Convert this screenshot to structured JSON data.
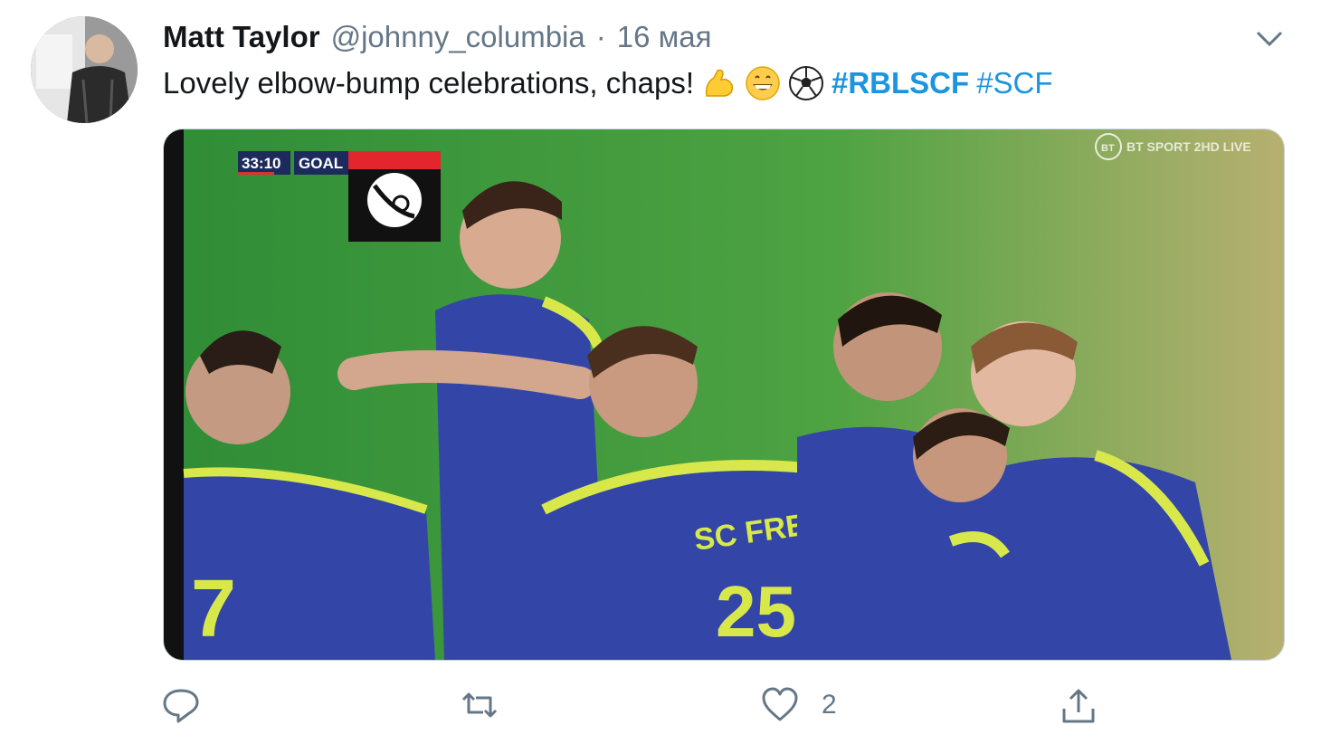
{
  "tweet": {
    "author_name": "Matt Taylor",
    "author_handle": "@johnny_columbia",
    "separator": "·",
    "date": "16 мая",
    "text": "Lovely elbow-bump celebrations, chaps!",
    "emojis": [
      "flexed-biceps-icon",
      "grinning-face-icon",
      "soccer-ball-icon"
    ],
    "hashtags": [
      "#RBLSCF",
      "#SCF"
    ]
  },
  "media": {
    "scorebug_time": "33:10",
    "scorebug_label": "GOAL",
    "broadcaster": "BT SPORT 2HD LIVE",
    "shirt_text": "SC FREIBURG",
    "shirt_number": "25"
  },
  "actions": {
    "reply_count": "",
    "retweet_count": "",
    "like_count": "2"
  },
  "colors": {
    "hashtag": "#1b95e0",
    "muted": "#657786",
    "pitch": "#3c9a3c",
    "kit": "#3346a8",
    "kit_trim": "#d8e84a"
  }
}
